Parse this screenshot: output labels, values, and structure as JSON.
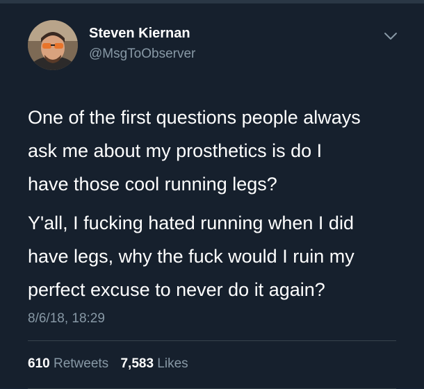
{
  "tweet": {
    "author": {
      "display_name": "Steven Kiernan",
      "handle": "@MsgToObserver"
    },
    "text_paragraph_1": "One of the first questions people always\nask me about my prosthetics is do I\nhave those cool running legs?",
    "text_paragraph_2": "Y'all, I fucking hated running when I did\nhave legs, why the fuck would I ruin my\nperfect excuse to never do it again?",
    "timestamp": "8/6/18, 18:29",
    "stats": {
      "retweets_count": "610",
      "retweets_label": "Retweets",
      "likes_count": "7,583",
      "likes_label": "Likes"
    }
  },
  "icons": {
    "avatar": "avatar-photo",
    "menu": "chevron-down-icon"
  },
  "colors": {
    "background": "#16202d",
    "text_primary": "#ffffff",
    "text_secondary": "#8899a6",
    "divider": "#38444d"
  }
}
